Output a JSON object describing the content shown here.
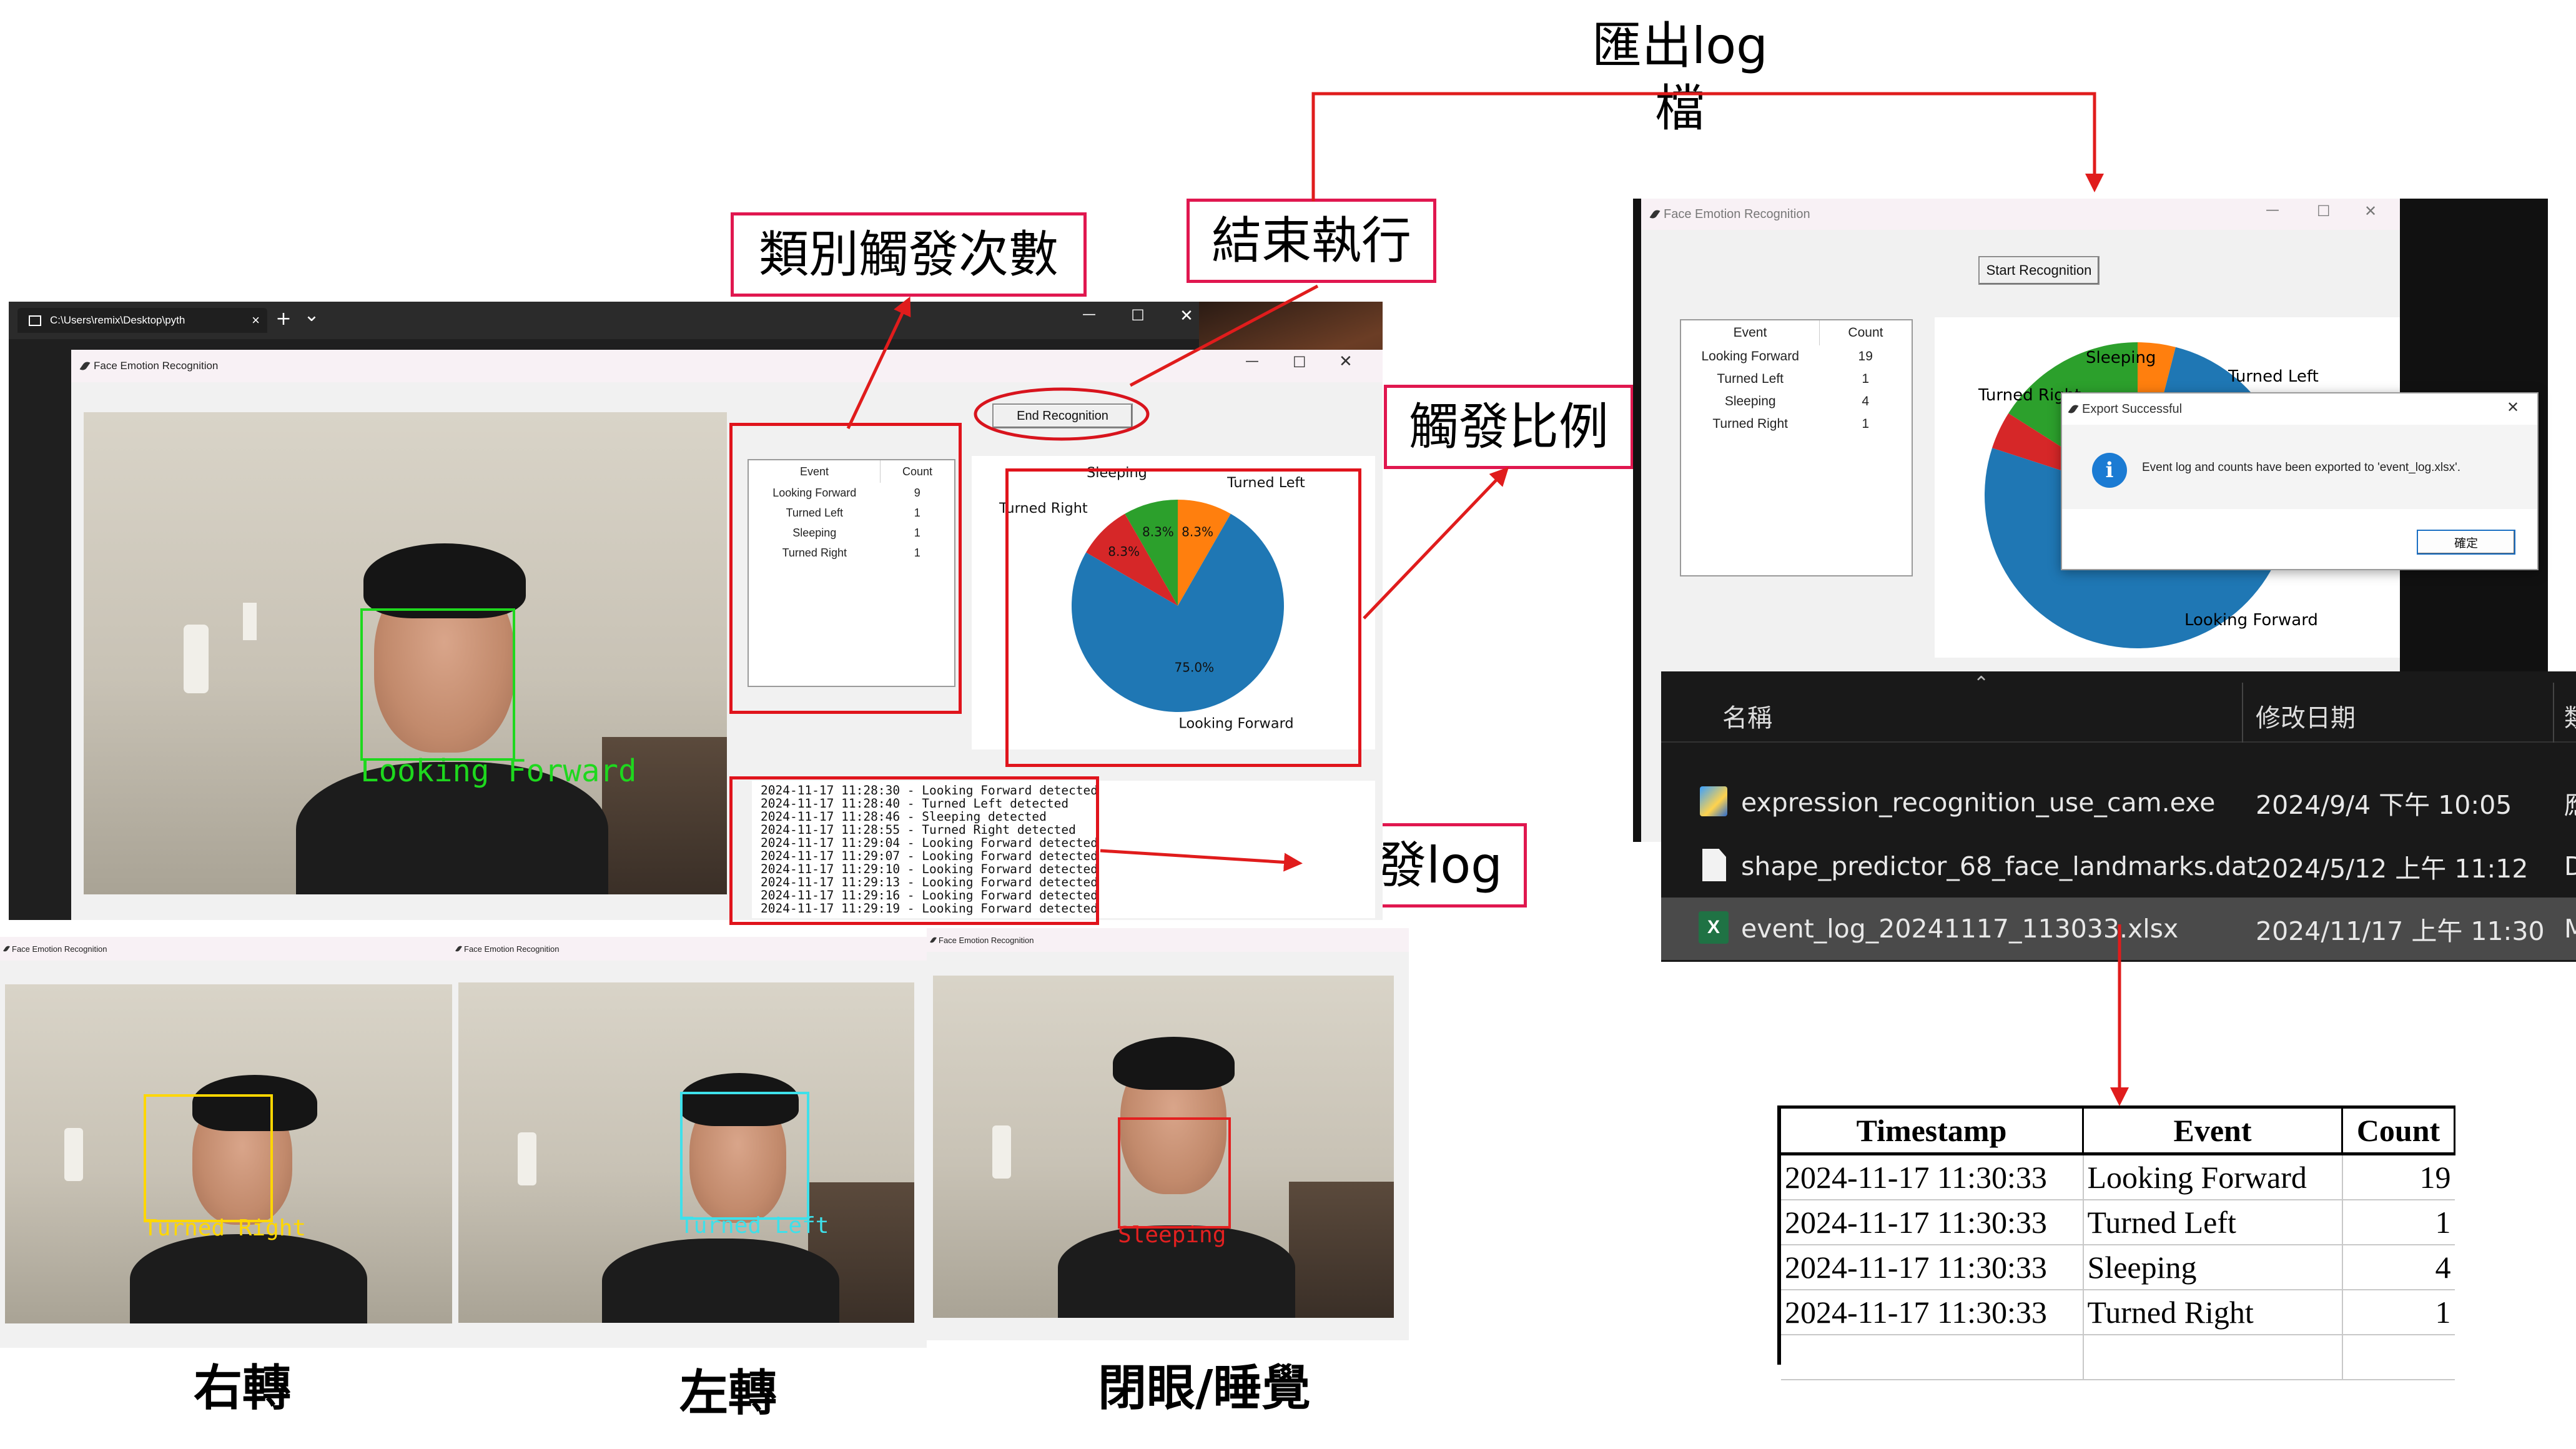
{
  "annotations": {
    "export_log": "匯出log檔",
    "category_count": "類別觸發次數",
    "end_run": "結束執行",
    "trigger_ratio": "觸發比例",
    "trigger_log": "觸發log"
  },
  "terminal": {
    "tab_title": "C:\\Users\\remix\\Desktop\\pyth",
    "close_tab": "×",
    "new_tab": "+",
    "dropdown": "⌄",
    "minimize": "—",
    "maximize": "☐",
    "close": "✕"
  },
  "main_window": {
    "title": "Face Emotion Recognition",
    "end_button": "End Recognition",
    "camera_label": "Looking Forward",
    "table": {
      "headers": [
        "Event",
        "Count"
      ],
      "rows": [
        {
          "event": "Looking Forward",
          "count": "9"
        },
        {
          "event": "Turned Left",
          "count": "1"
        },
        {
          "event": "Sleeping",
          "count": "1"
        },
        {
          "event": "Turned Right",
          "count": "1"
        }
      ]
    },
    "log_lines": [
      "2024-11-17 11:28:30 - Looking Forward detected",
      "2024-11-17 11:28:40 - Turned Left detected",
      "2024-11-17 11:28:46 - Sleeping detected",
      "2024-11-17 11:28:55 - Turned Right detected",
      "2024-11-17 11:29:04 - Looking Forward detected",
      "2024-11-17 11:29:07 - Looking Forward detected",
      "2024-11-17 11:29:10 - Looking Forward detected",
      "2024-11-17 11:29:13 - Looking Forward detected",
      "2024-11-17 11:29:16 - Looking Forward detected",
      "2024-11-17 11:29:19 - Looking Forward detected"
    ]
  },
  "chart_data": [
    {
      "type": "pie",
      "labels": [
        "Looking Forward",
        "Turned Right",
        "Sleeping",
        "Turned Left"
      ],
      "values": [
        75.0,
        8.3,
        8.3,
        8.3
      ],
      "value_labels": [
        "75.0%",
        "8.3%",
        "8.3%",
        "8.3%"
      ],
      "colors": [
        "#1f77b4",
        "#d62728",
        "#2ca02c",
        "#ff7f0e"
      ]
    },
    {
      "type": "pie",
      "labels": [
        "Looking Forward",
        "Turned Right",
        "Sleeping",
        "Turned Left"
      ],
      "values": [
        76.0,
        4.0,
        16.0,
        4.0
      ],
      "colors": [
        "#1f77b4",
        "#d62728",
        "#2ca02c",
        "#ff7f0e"
      ]
    }
  ],
  "small_windows": [
    {
      "title": "Face Emotion Recognition",
      "label": "Turned Right",
      "color": "#ffd700",
      "caption": "右轉"
    },
    {
      "title": "Face Emotion Recognition",
      "label": "Turned Left",
      "color": "#3ee0ea",
      "caption": "左轉"
    },
    {
      "title": "Face Emotion Recognition",
      "label": "Sleeping",
      "color": "#e32020",
      "caption": "閉眼/睡覺"
    }
  ],
  "export_window": {
    "title": "Face Emotion Recognition",
    "start_button": "Start Recognition",
    "table": {
      "headers": [
        "Event",
        "Count"
      ],
      "rows": [
        {
          "event": "Looking Forward",
          "count": "19"
        },
        {
          "event": "Turned Left",
          "count": "1"
        },
        {
          "event": "Sleeping",
          "count": "4"
        },
        {
          "event": "Turned Right",
          "count": "1"
        }
      ]
    },
    "pie_labels": {
      "sleeping": "Sleeping",
      "turned_left": "Turned Left",
      "turned_right": "Turned Right",
      "looking_forward": "Looking Forward"
    },
    "dialog": {
      "title": "Export Successful",
      "message": "Event log and counts have been exported to 'event_log.xlsx'.",
      "ok_button": "確定",
      "close": "✕",
      "info_glyph": "i"
    }
  },
  "explorer": {
    "headers": {
      "name": "名稱",
      "modified": "修改日期",
      "type_partial": "類"
    },
    "files": [
      {
        "name": "expression_recognition_use_cam.exe",
        "modified": "2024/9/4 下午 10:05",
        "type_partial": "應",
        "icon": "exe-icon",
        "selected": false
      },
      {
        "name": "shape_predictor_68_face_landmarks.dat",
        "modified": "2024/5/12 上午 11:12",
        "type_partial": "D",
        "icon": "file-icon",
        "selected": false
      },
      {
        "name": "event_log_20241117_113033.xlsx",
        "modified": "2024/11/17 上午 11:30",
        "type_partial": "M",
        "icon": "excel-icon",
        "selected": true
      }
    ]
  },
  "excel": {
    "headers": [
      "Timestamp",
      "Event",
      "Count"
    ],
    "rows": [
      [
        "2024-11-17 11:30:33",
        "Looking Forward",
        "19"
      ],
      [
        "2024-11-17 11:30:33",
        "Turned Left",
        "1"
      ],
      [
        "2024-11-17 11:30:33",
        "Sleeping",
        "4"
      ],
      [
        "2024-11-17 11:30:33",
        "Turned Right",
        "1"
      ]
    ]
  }
}
